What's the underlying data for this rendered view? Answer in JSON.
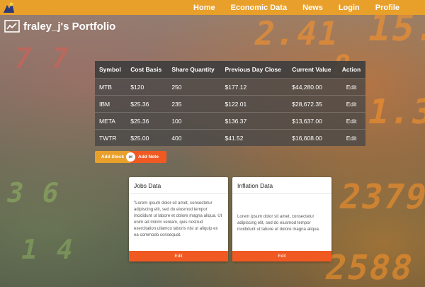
{
  "nav": {
    "items": [
      "Home",
      "Economic Data",
      "News",
      "Login",
      "Profile"
    ]
  },
  "page_title": "fraley_j's Portfolio",
  "icons": {
    "logo": "logo-icon",
    "title": "line-chart-icon"
  },
  "colors": {
    "topbar": "#e9a02b",
    "accent": "#f05a22",
    "add_stock": "#e9a02b"
  },
  "table": {
    "headers": [
      "Symbol",
      "Cost Basis",
      "Share Quantity",
      "Previous Day Close",
      "Current Value",
      "Action"
    ],
    "rows": [
      [
        "MTB",
        "$120",
        "250",
        "$177.12",
        "$44,280.00",
        "Edit"
      ],
      [
        "IBM",
        "$25.36",
        "235",
        "$122.01",
        "$28,672.35",
        "Edit"
      ],
      [
        "META",
        "$25.36",
        "100",
        "$136.37",
        "$13,637.00",
        "Edit"
      ],
      [
        "TWTR",
        "$25.00",
        "400",
        "$41.52",
        "$16,608.00",
        "Edit"
      ]
    ]
  },
  "actions": {
    "add_stock": "Add Stock",
    "or": "or",
    "add_note": "Add Note"
  },
  "cards": {
    "jobs": {
      "title": "Jobs Data",
      "body": "\"Lorem ipsum dolor sit amet, consectetur adipiscing elit, sed do eiusmod tempor incididunt ut labore et dolore magna aliqua. Ut enim ad minim veniam, quis nostrud exercitation ullamco laboris nisi ut aliquip ex ea commodo consequat.",
      "button": "Edit"
    },
    "inflation": {
      "title": "Inflation Data",
      "body": "Lorem ipsum dolor sit amet, consectetur adipiscing elit, sed do eiusmod tempor incididunt ut labore et dolore magna aliqua.",
      "button": "Edit"
    }
  }
}
